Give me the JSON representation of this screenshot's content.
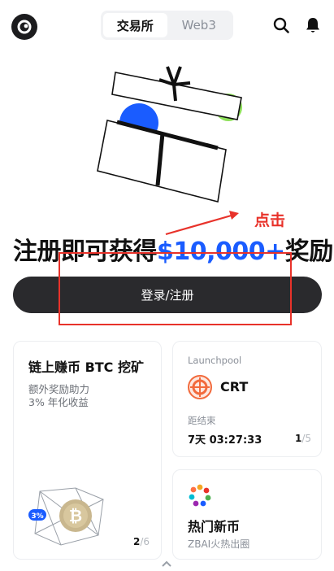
{
  "header": {
    "logo_icon": "exchange-logo-icon",
    "tabs": [
      {
        "label": "交易所",
        "active": true
      },
      {
        "label": "Web3",
        "active": false
      }
    ],
    "search_icon": "search-icon",
    "bell_icon": "bell-icon"
  },
  "hero": {
    "illustration_icon": "gift-box-illustration",
    "annotation": "点击",
    "headline_prefix": "注册即可获得",
    "headline_amount": "$10,000+",
    "headline_suffix": "奖励",
    "cta_label": "登录/注册"
  },
  "cards": {
    "mining": {
      "title": "链上赚币 BTC 挖矿",
      "subtitle1": "额外奖励助力",
      "subtitle2": "3% 年化收益",
      "badge": "3%",
      "page_current": "2",
      "page_total": "/6"
    },
    "launchpool": {
      "label": "Launchpool",
      "token": "CRT",
      "countdown_label": "距结束",
      "countdown_value": "7天 03:27:33",
      "page_current": "1",
      "page_total": "/5"
    },
    "hot": {
      "title": "热门新币",
      "subtitle": "ZBAI火热出圈"
    }
  },
  "colors": {
    "accent_blue": "#1a5cff",
    "cta_bg": "#2a2a2d",
    "annotation_red": "#e8322a"
  }
}
